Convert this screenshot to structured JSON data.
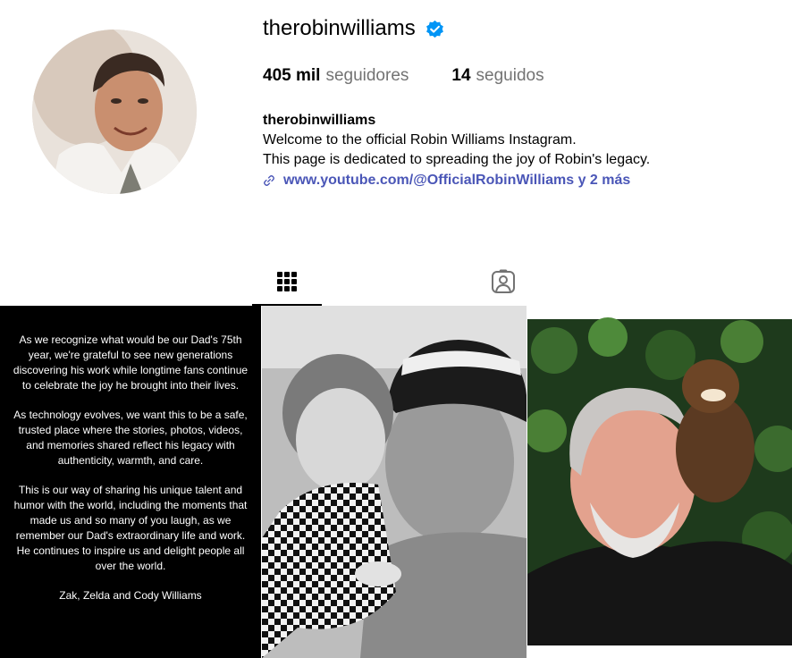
{
  "profile": {
    "username": "therobinwilliams",
    "verified": true,
    "followers_count": "405 mil",
    "followers_label": "seguidores",
    "following_count": "14",
    "following_label": "seguidos"
  },
  "bio": {
    "name": "therobinwilliams",
    "line1": "Welcome to the official Robin Williams Instagram.",
    "line2": "This page is dedicated to spreading the joy of Robin's legacy.",
    "link_text": "www.youtube.com/@OfficialRobinWilliams y 2 más"
  },
  "tabs": [
    {
      "icon": "grid-icon",
      "active": true
    },
    {
      "icon": "tagged-icon",
      "active": false
    }
  ],
  "posts": {
    "text_post": {
      "paragraph1": "As we recognize what would be our Dad's 75th year, we're grateful to see new generations discovering his work while longtime fans continue to celebrate the joy he brought into their lives.",
      "paragraph2": "As technology evolves, we want this to be a safe, trusted place where the stories, photos, videos, and memories shared reflect his legacy with authenticity, warmth, and care.",
      "paragraph3": "This is our way of sharing his unique talent and humor with the world, including the moments that made us and so many of you laugh, as we remember our Dad's extraordinary life and work. He continues to inspire us and delight people all over the world.",
      "signature": "Zak, Zelda and Cody Williams"
    }
  },
  "colors": {
    "verified_badge": "#0095f6",
    "link": "#4a56b7",
    "secondary_text": "#737373"
  }
}
